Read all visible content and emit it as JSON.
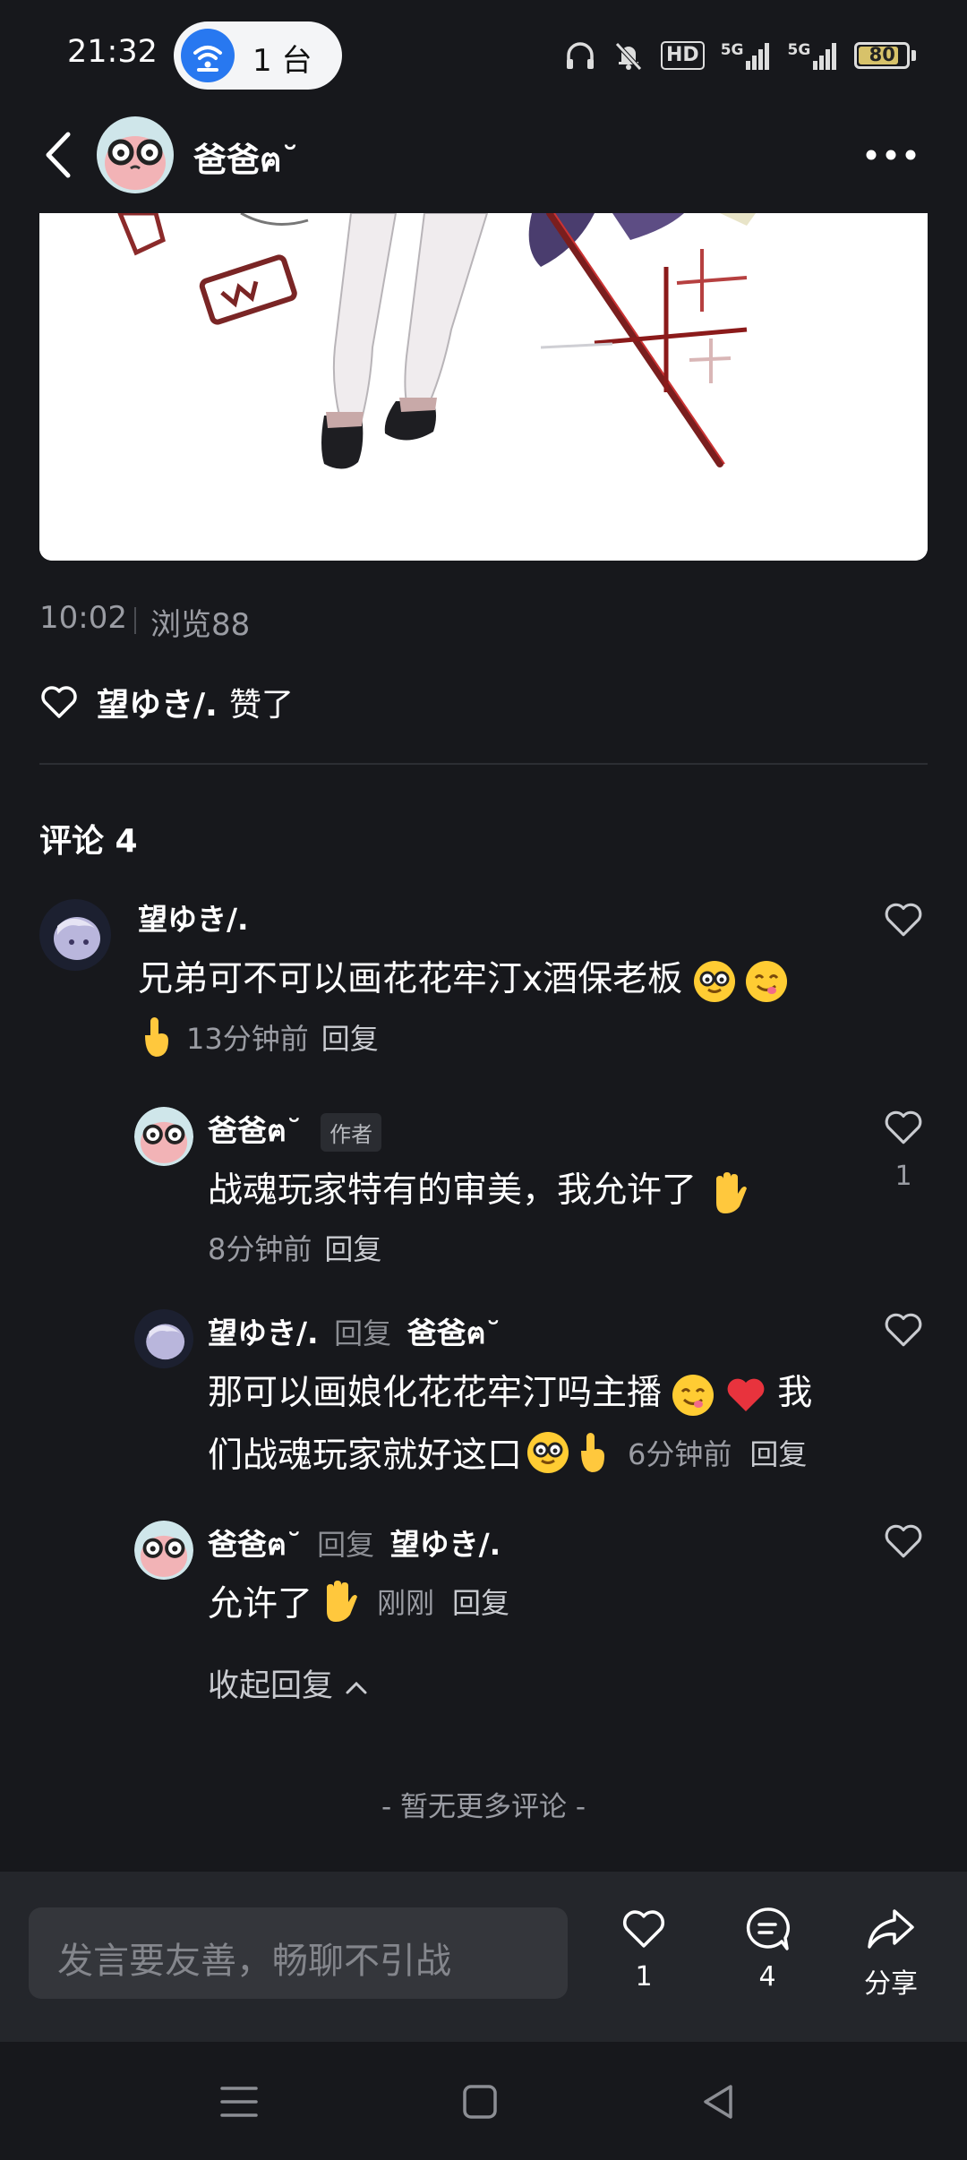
{
  "status_bar": {
    "time": "21:32",
    "hotspot_count": "1 台",
    "hd_label": "HD",
    "sig1_label": "5G",
    "sig2_label": "5G",
    "battery_level": "80",
    "battery_color": "#d7c26a"
  },
  "header": {
    "title": "爸爸ฅ˘"
  },
  "post": {
    "time": "10:02",
    "views": "浏览88"
  },
  "likes": {
    "liker": "望ゆき/.",
    "action": "赞了"
  },
  "comments": {
    "header": "评论 4",
    "items": [
      {
        "author": "望ゆき/.",
        "text_line1": "兄弟可不可以画花花牢汀x酒保老板",
        "time": "13分钟前",
        "reply": "回复"
      },
      {
        "author": "爸爸ฅ˘",
        "tag": "作者",
        "text": "战魂玩家特有的审美，我允许了",
        "time": "8分钟前",
        "reply": "回复",
        "likes": "1"
      },
      {
        "author": "望ゆき/.",
        "reply_word": "回复",
        "reply_to": "爸爸ฅ˘",
        "text_line1": "那可以画娘化花花牢汀吗主播",
        "text_line1_end": "我",
        "text_line2": "们战魂玩家就好这口",
        "time": "6分钟前",
        "reply": "回复"
      },
      {
        "author": "爸爸ฅ˘",
        "reply_word": "回复",
        "reply_to": "望ゆき/.",
        "text": "允许了",
        "time": "刚刚",
        "reply": "回复"
      }
    ],
    "collapse": "收起回复",
    "no_more": "- 暂无更多评论 -"
  },
  "bottom_bar": {
    "placeholder": "发言要友善，畅聊不引战",
    "like_count": "1",
    "comment_count": "4",
    "share_label": "分享"
  }
}
